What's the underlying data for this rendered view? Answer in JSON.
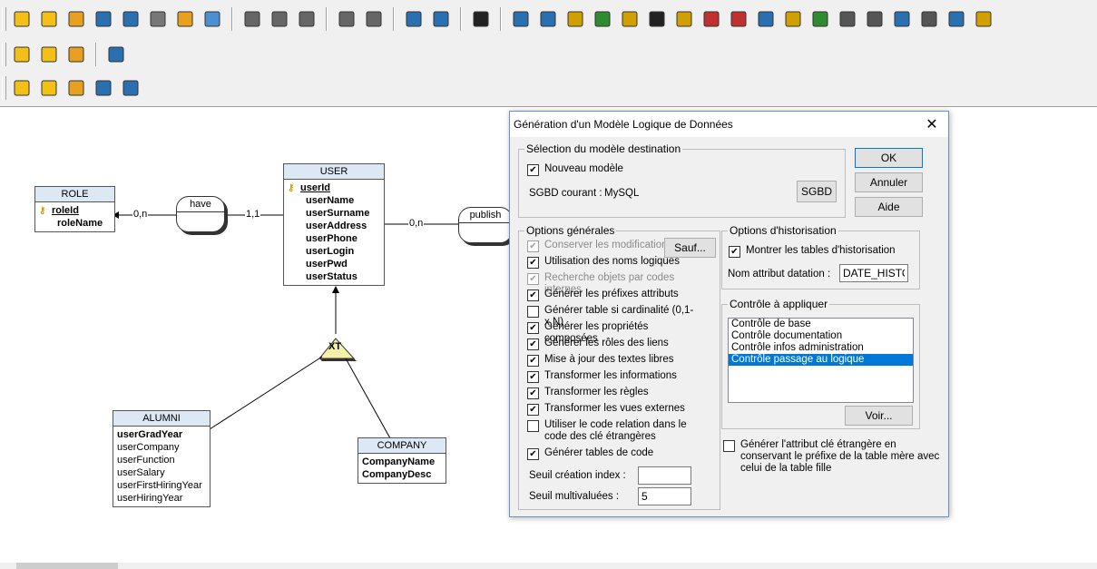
{
  "toolbar": {
    "row1_icons": [
      "new-document-icon",
      "new-folder-icon",
      "open-icon",
      "save-icon",
      "save-all-icon",
      "print-icon",
      "export-icon",
      "web-icon",
      "cut-icon",
      "copy-icon",
      "paste-icon",
      "undo-icon",
      "redo-icon",
      "zoom-icon",
      "grid-icon",
      "help-pointer-icon",
      "entity-tool-icon",
      "association-tool-icon",
      "inheritance-tool-icon",
      "constraint-tool-icon",
      "note-tool-icon",
      "info-tool-icon",
      "question-tool-icon",
      "link-tool-icon",
      "table-tool-icon",
      "view-tool-icon",
      "folder-tool-icon",
      "package-tool-icon",
      "group-tool-icon",
      "hierarchy-tool-icon",
      "matrix-tool-icon",
      "search-tool-icon",
      "select-tool-icon",
      "sheet-tool-icon"
    ],
    "row2_icons": [
      "lock-icon",
      "users-icon",
      "shield-icon",
      "filter-icon"
    ],
    "row3_icons": [
      "layers-icon",
      "model-icon",
      "generate-icon",
      "flag-icon",
      "binoculars-icon"
    ]
  },
  "diagram": {
    "role": {
      "name": "ROLE",
      "attributes": [
        "roleId",
        "roleName"
      ]
    },
    "user": {
      "name": "USER",
      "attributes": [
        "userId",
        "userName",
        "userSurname",
        "userAddress",
        "userPhone",
        "userLogin",
        "userPwd",
        "userStatus"
      ]
    },
    "alumni": {
      "name": "ALUMNI",
      "attributes": [
        "userGradYear",
        "userCompany",
        "userFunction",
        "userSalary",
        "userFirstHiringYear",
        "userHiringYear"
      ]
    },
    "company": {
      "name": "COMPANY",
      "attributes": [
        "CompanyName",
        "CompanyDesc"
      ]
    },
    "have": {
      "name": "have",
      "card_left": "0,n",
      "card_right": "1,1"
    },
    "publish": {
      "name": "publish",
      "card_left": "0,n"
    },
    "inheritance": {
      "label": "XT"
    }
  },
  "dialog": {
    "title": "Génération d'un Modèle Logique de Données",
    "close": "✕",
    "dest_group": {
      "label": "Sélection du modèle destination",
      "new_model": {
        "label": "Nouveau modèle",
        "checked": true
      },
      "sgbd_label": "SGBD courant :",
      "sgbd_value": "MySQL",
      "sgbd_button": "SGBD"
    },
    "buttons": {
      "ok": "OK",
      "cancel": "Annuler",
      "help": "Aide"
    },
    "general_group": {
      "label": "Options générales",
      "save_button": "Sauf...",
      "options": [
        {
          "label": "Conserver les modifications",
          "checked": true,
          "disabled": true
        },
        {
          "label": "Utilisation des noms logiques",
          "checked": true,
          "disabled": false
        },
        {
          "label": "Recherche objets par codes internes",
          "checked": true,
          "disabled": true
        },
        {
          "label": "Générer les préfixes attributs",
          "checked": true,
          "disabled": false
        },
        {
          "label": "Générer table si cardinalité (0,1-x,N)",
          "checked": false,
          "disabled": false
        },
        {
          "label": "Générer les propriétés composées",
          "checked": true,
          "disabled": false
        },
        {
          "label": "Générer les rôles des liens",
          "checked": true,
          "disabled": false
        },
        {
          "label": "Mise à jour des textes libres",
          "checked": true,
          "disabled": false
        },
        {
          "label": "Transformer les informations",
          "checked": true,
          "disabled": false
        },
        {
          "label": "Transformer les règles",
          "checked": true,
          "disabled": false
        },
        {
          "label": "Transformer les vues externes",
          "checked": true,
          "disabled": false
        },
        {
          "label": "Utiliser le code relation dans le code des clé étrangères",
          "checked": false,
          "disabled": false
        },
        {
          "label": "Générer tables de code",
          "checked": true,
          "disabled": false
        }
      ],
      "index_threshold_label": "Seuil création index :",
      "index_threshold_value": "",
      "multivalue_threshold_label": "Seuil multivaluées :",
      "multivalue_threshold_value": "5"
    },
    "history_group": {
      "label": "Options d'historisation",
      "show_history": {
        "label": "Montrer les tables d'historisation",
        "checked": true
      },
      "date_attr_label": "Nom attribut datation :",
      "date_attr_value": "DATE_HISTO"
    },
    "control_group": {
      "label": "Contrôle à appliquer",
      "items": [
        {
          "label": "Contrôle de base",
          "selected": false
        },
        {
          "label": "Contrôle documentation",
          "selected": false
        },
        {
          "label": "Contrôle infos administration",
          "selected": false
        },
        {
          "label": "Contrôle passage au logique",
          "selected": true
        }
      ],
      "view_button": "Voir..."
    },
    "fk_option": {
      "label": "Générer l'attribut clé étrangère en conservant le préfixe de la table mère avec celui de la table fille",
      "checked": false
    }
  }
}
